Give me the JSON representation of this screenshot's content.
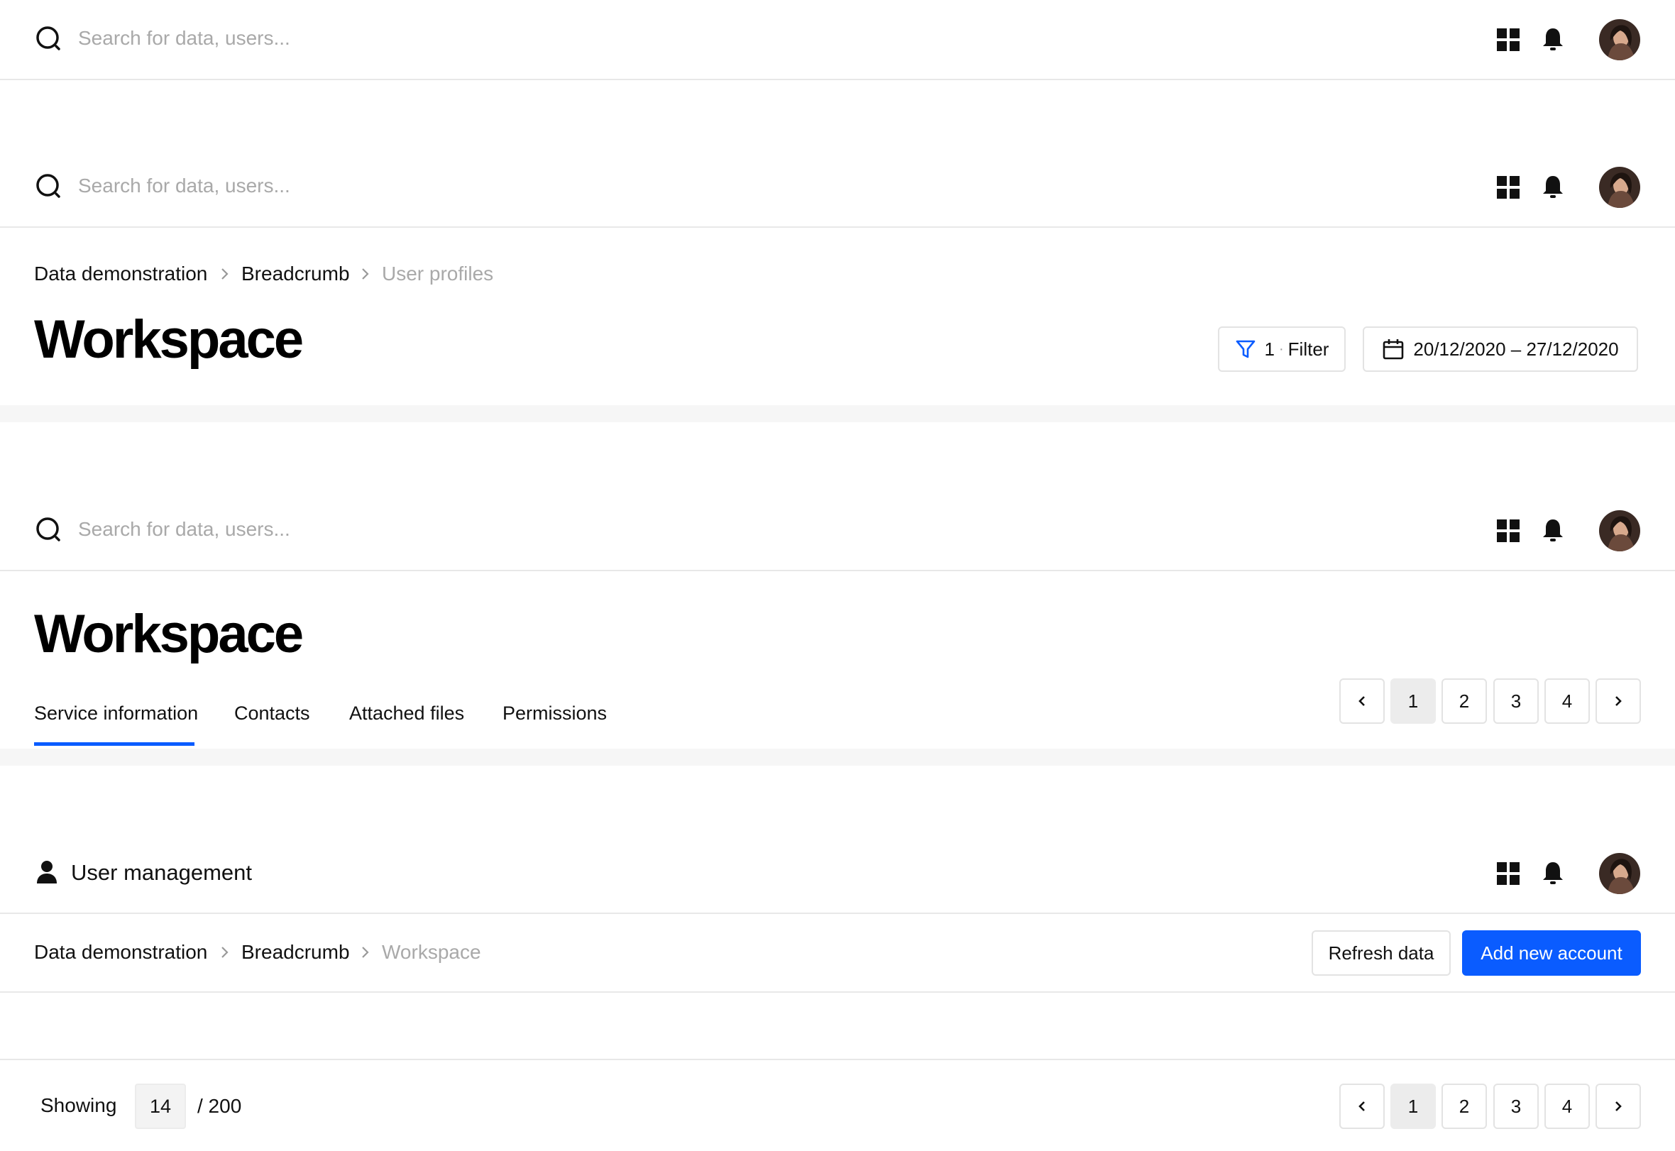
{
  "search": {
    "placeholder": "Search for data, users..."
  },
  "header1": {
    "search_text": "Search for data, users..."
  },
  "header2": {
    "search_text": "Search for data, users..."
  },
  "header3": {
    "search_text": "Search for data, users..."
  },
  "header4": {
    "title": "User management"
  },
  "breadcrumb1": {
    "items": [
      "Data demonstration",
      "Breadcrumb",
      "User profiles"
    ]
  },
  "breadcrumb2": {
    "items": [
      "Data demonstration",
      "Breadcrumb",
      "Workspace"
    ]
  },
  "workspace1": {
    "title": "Workspace",
    "filter_count": "1",
    "filter_sep": "·",
    "filter_label": "Filter",
    "date_range": "20/12/2020 – 27/12/2020"
  },
  "workspace2": {
    "title": "Workspace",
    "tabs": [
      "Service information",
      "Contacts",
      "Attached files",
      "Permissions"
    ],
    "active_tab": "Service information"
  },
  "pagination": {
    "pages": [
      "1",
      "2",
      "3",
      "4"
    ],
    "current": "1"
  },
  "actions": {
    "refresh_label": "Refresh data",
    "add_label": "Add new account"
  },
  "footer": {
    "showing_label": "Showing",
    "count": "14",
    "total": "/ 200"
  },
  "colors": {
    "accent": "#0a5cff",
    "border": "#e3e3e3",
    "muted": "#a9a9a9"
  },
  "icons": [
    "search-icon",
    "grid-icon",
    "bell-icon",
    "avatar",
    "filter-icon",
    "calendar-icon",
    "user-icon",
    "chevron-left-icon",
    "chevron-right-icon"
  ]
}
